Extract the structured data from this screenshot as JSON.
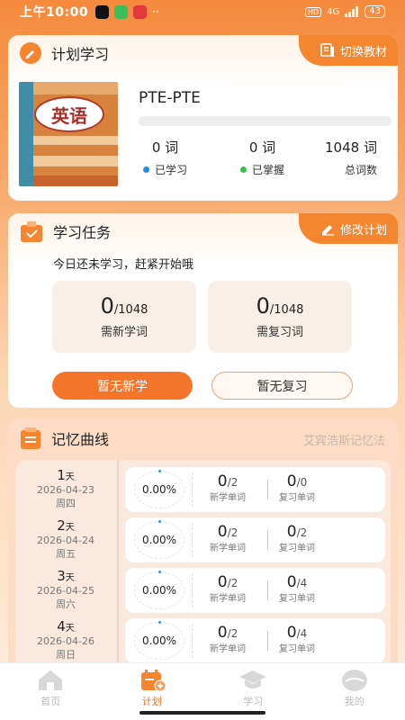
{
  "status_bar": {
    "time": "上午10:00",
    "network": "4G",
    "battery": "43"
  },
  "plan": {
    "title": "计划学习",
    "switch_label": "切换教材",
    "book_cover_text": "英语",
    "book_name": "PTE-PTE",
    "progress_fraction": 0,
    "stats": [
      {
        "value": "0 词",
        "label": "已学习",
        "dot_color": "#2a8be0"
      },
      {
        "value": "0 词",
        "label": "已掌握",
        "dot_color": "#36c24a"
      },
      {
        "value": "1048 词",
        "label": "总词数"
      }
    ]
  },
  "tasks": {
    "title": "学习任务",
    "edit_label": "修改计划",
    "tip": "今日还未学习，赶紧开始哦",
    "boxes": [
      {
        "value": "0",
        "total": "/1048",
        "label": "需新学词"
      },
      {
        "value": "0",
        "total": "/1048",
        "label": "需复习词"
      }
    ],
    "learn_button": "暂无新学",
    "review_button": "暂无复习"
  },
  "curve": {
    "title": "记忆曲线",
    "method": "艾宾浩斯记忆法",
    "day_unit": "天",
    "new_label": "新学单词",
    "review_label": "复习单词",
    "rows": [
      {
        "day": "1",
        "date": "2026-04-23",
        "week": "周四",
        "percent": "0.00%",
        "new_done": "0",
        "new_total": "/2",
        "review_done": "0",
        "review_total": "/0"
      },
      {
        "day": "2",
        "date": "2026-04-24",
        "week": "周五",
        "percent": "0.00%",
        "new_done": "0",
        "new_total": "/2",
        "review_done": "0",
        "review_total": "/2"
      },
      {
        "day": "3",
        "date": "2026-04-25",
        "week": "周六",
        "percent": "0.00%",
        "new_done": "0",
        "new_total": "/2",
        "review_done": "0",
        "review_total": "/4"
      },
      {
        "day": "4",
        "date": "2026-04-26",
        "week": "周日",
        "percent": "0.00%",
        "new_done": "0",
        "new_total": "/2",
        "review_done": "0",
        "review_total": "/4"
      }
    ]
  },
  "nav": {
    "items": [
      {
        "label": "首页",
        "icon": "home-icon"
      },
      {
        "label": "计划",
        "icon": "calendar-plus-icon",
        "active": true
      },
      {
        "label": "学习",
        "icon": "graduation-cap-icon"
      },
      {
        "label": "我的",
        "icon": "profile-icon"
      }
    ]
  },
  "colors": {
    "accent": "#f4752a",
    "header": "#f58a3c",
    "tag": "#f4862f"
  }
}
